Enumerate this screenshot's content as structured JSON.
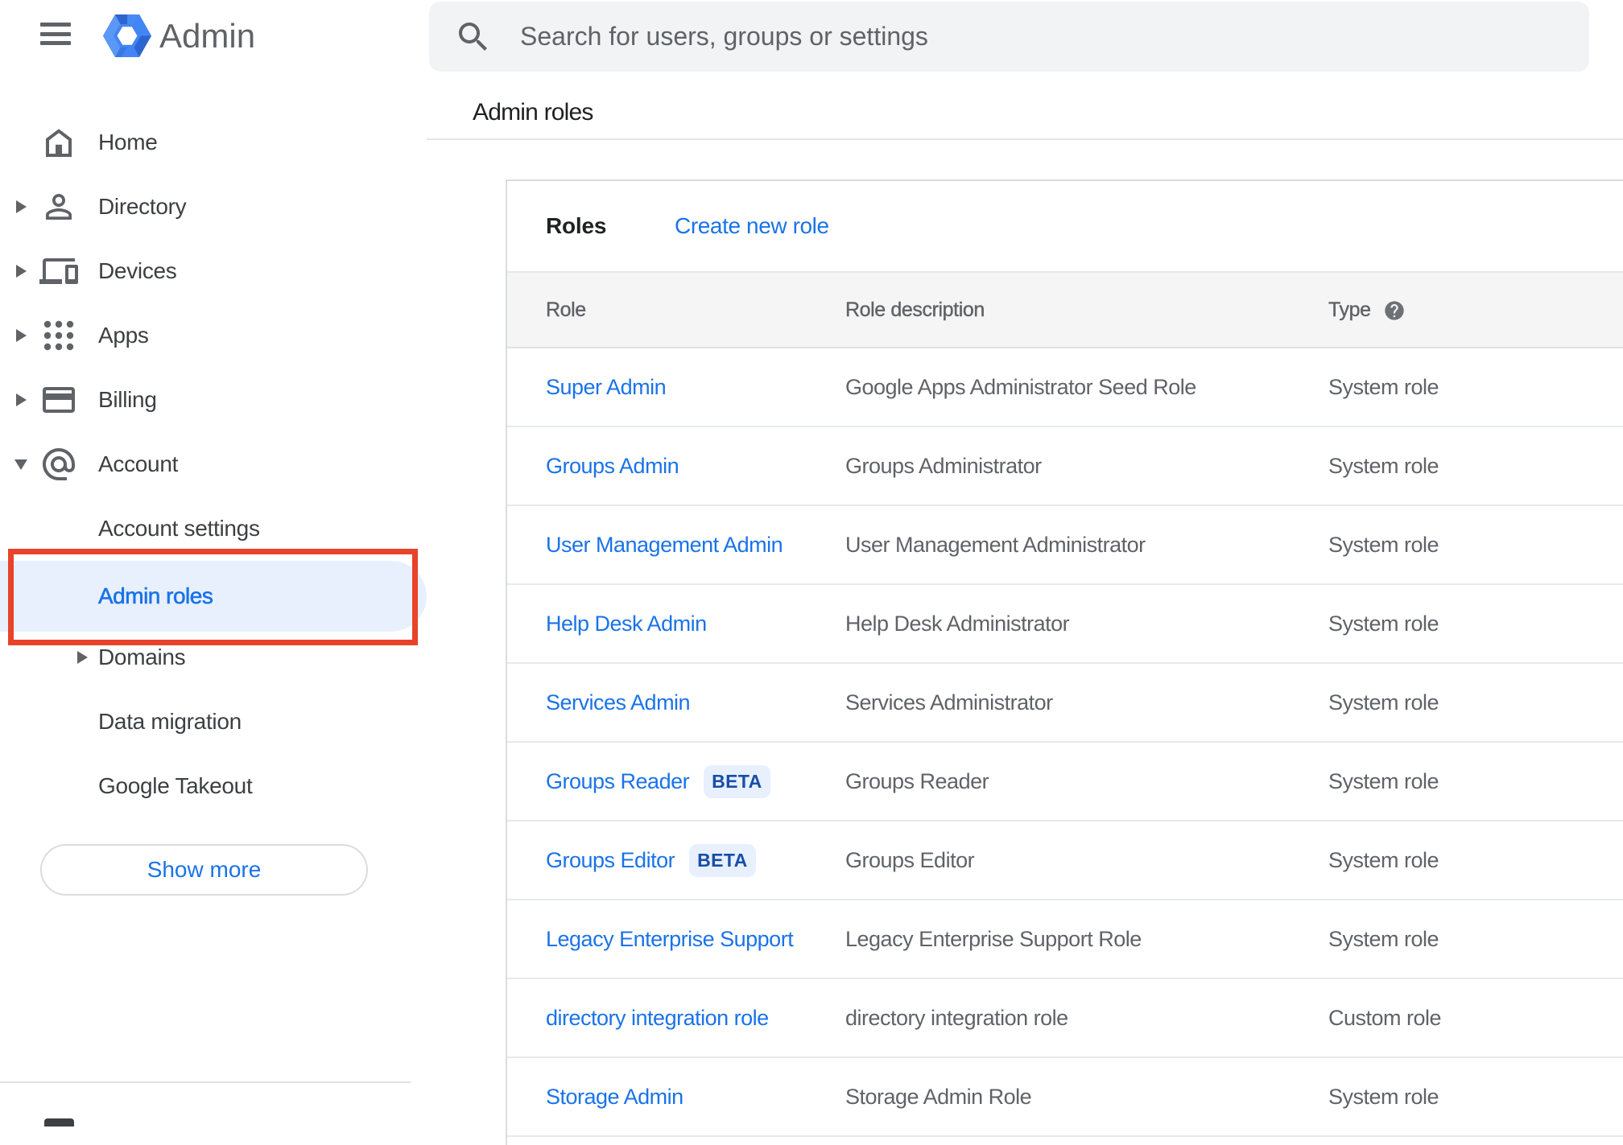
{
  "header": {
    "product_name": "Admin"
  },
  "search": {
    "placeholder": "Search for users, groups or settings"
  },
  "breadcrumb": "Admin roles",
  "sidebar": {
    "items": [
      {
        "label": "Home",
        "icon": "home"
      },
      {
        "label": "Directory",
        "icon": "person",
        "arrow": "right"
      },
      {
        "label": "Devices",
        "icon": "devices",
        "arrow": "right"
      },
      {
        "label": "Apps",
        "icon": "apps-grid",
        "arrow": "right"
      },
      {
        "label": "Billing",
        "icon": "credit-card",
        "arrow": "right"
      },
      {
        "label": "Account",
        "icon": "at-sign",
        "arrow": "down",
        "expanded": true
      },
      {
        "label": "Account settings"
      },
      {
        "label": "Admin roles",
        "selected": true,
        "annotated": true
      },
      {
        "label": "Domains",
        "arrow": "right"
      },
      {
        "label": "Data migration"
      },
      {
        "label": "Google Takeout"
      }
    ],
    "show_more_label": "Show more"
  },
  "content": {
    "card_title": "Roles",
    "create_link_label": "Create new role",
    "table": {
      "columns": {
        "role": "Role",
        "description": "Role description",
        "type": "Type"
      },
      "beta_label": "BETA",
      "rows": [
        {
          "role": "Super Admin",
          "description": "Google Apps Administrator Seed Role",
          "type": "System role"
        },
        {
          "role": "Groups Admin",
          "description": "Groups Administrator",
          "type": "System role"
        },
        {
          "role": "User Management Admin",
          "description": "User Management Administrator",
          "type": "System role"
        },
        {
          "role": "Help Desk Admin",
          "description": "Help Desk Administrator",
          "type": "System role"
        },
        {
          "role": "Services Admin",
          "description": "Services Administrator",
          "type": "System role"
        },
        {
          "role": "Groups Reader",
          "beta": true,
          "description": "Groups Reader",
          "type": "System role"
        },
        {
          "role": "Groups Editor",
          "beta": true,
          "description": "Groups Editor",
          "type": "System role"
        },
        {
          "role": "Legacy Enterprise Support",
          "description": "Legacy Enterprise Support Role",
          "type": "System role"
        },
        {
          "role": "directory integration role",
          "description": "directory integration role",
          "type": "Custom role"
        },
        {
          "role": "Storage Admin",
          "description": "Storage Admin Role",
          "type": "System role"
        }
      ]
    }
  },
  "colors": {
    "accent_blue": "#1a73e8",
    "selected_pill_bg": "#e8f0fe",
    "annotation_red": "#e8432a",
    "icon_gray": "#5f6368",
    "beta_text": "#174ea6",
    "beta_bg": "#e8f0fe"
  }
}
